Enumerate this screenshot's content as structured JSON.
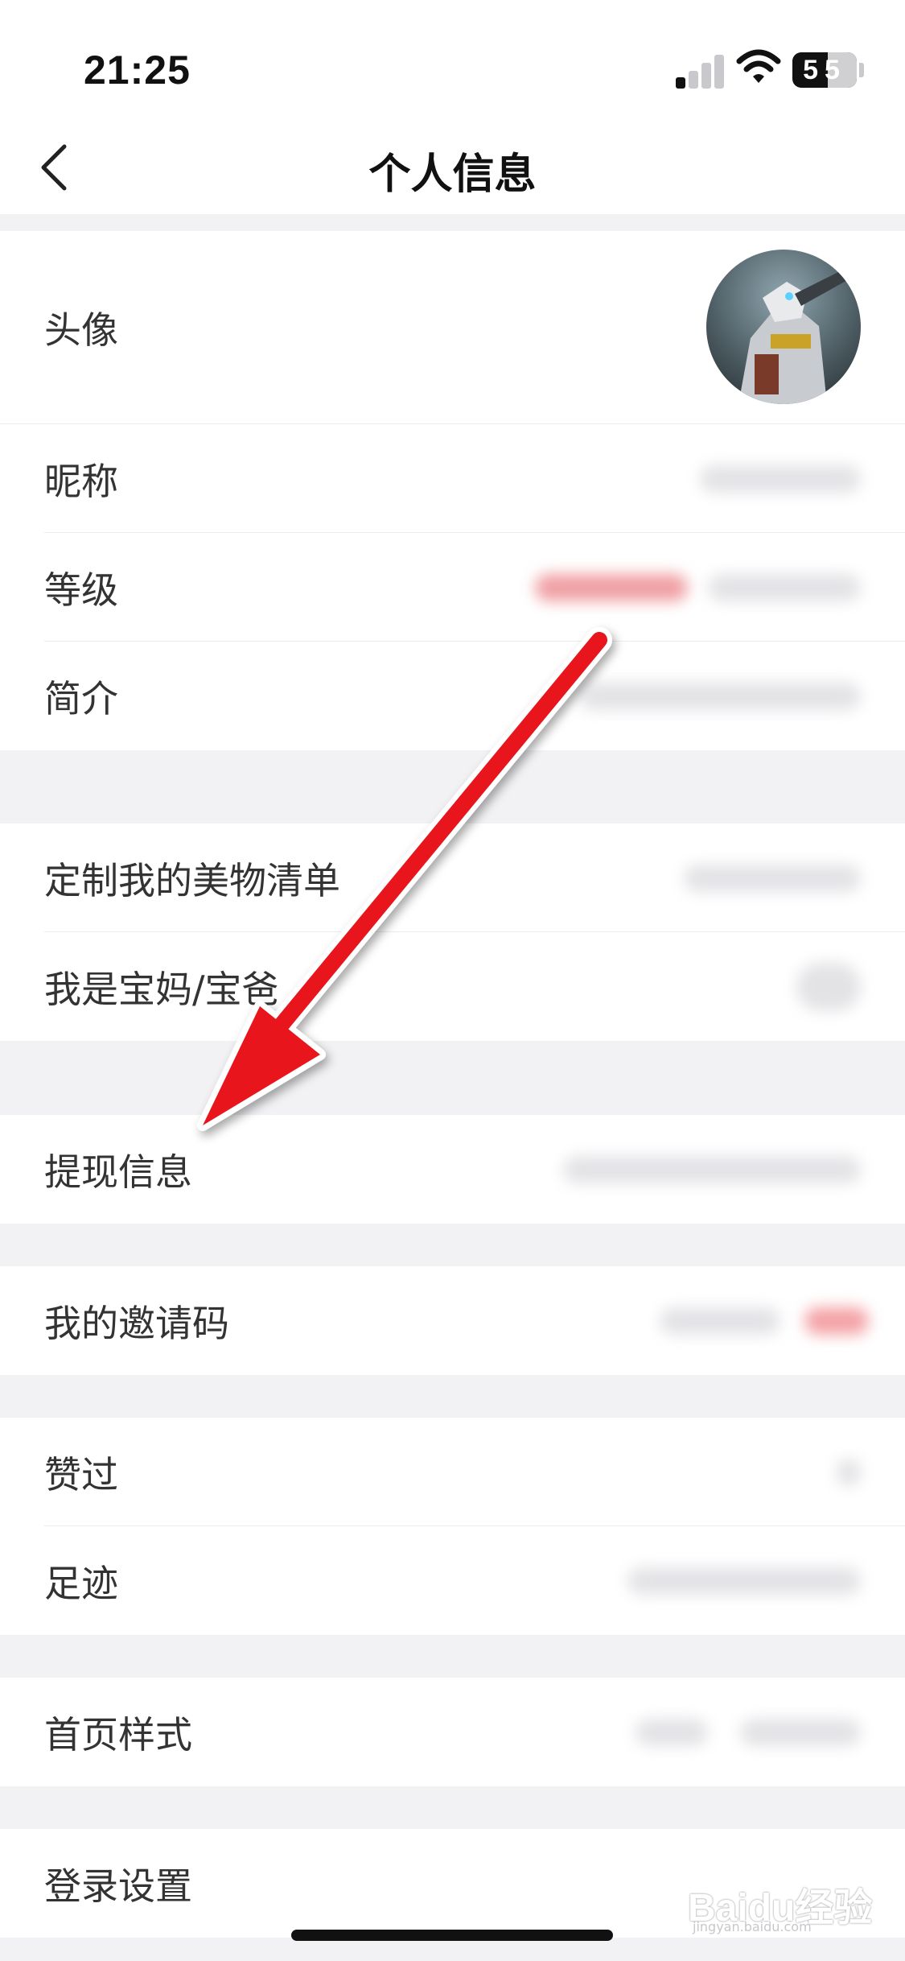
{
  "status_bar": {
    "time": "21:25",
    "battery_level": "55"
  },
  "nav": {
    "title": "个人信息"
  },
  "profile": {
    "avatar_label": "头像",
    "nickname_label": "昵称",
    "level_label": "等级",
    "bio_label": "简介"
  },
  "prefs": {
    "custom_list_label": "定制我的美物清单",
    "parent_label": "我是宝妈/宝爸"
  },
  "withdraw": {
    "label": "提现信息"
  },
  "invite": {
    "label": "我的邀请码"
  },
  "activity": {
    "likes_label": "赞过",
    "footprint_label": "足迹"
  },
  "homepage": {
    "style_label": "首页样式"
  },
  "login": {
    "settings_label": "登录设置"
  },
  "watermark": {
    "brand": "Baidu经验",
    "site": "jingyan.baidu.com"
  },
  "colors": {
    "accent_red": "#e8141c",
    "background": "#f2f2f5"
  }
}
